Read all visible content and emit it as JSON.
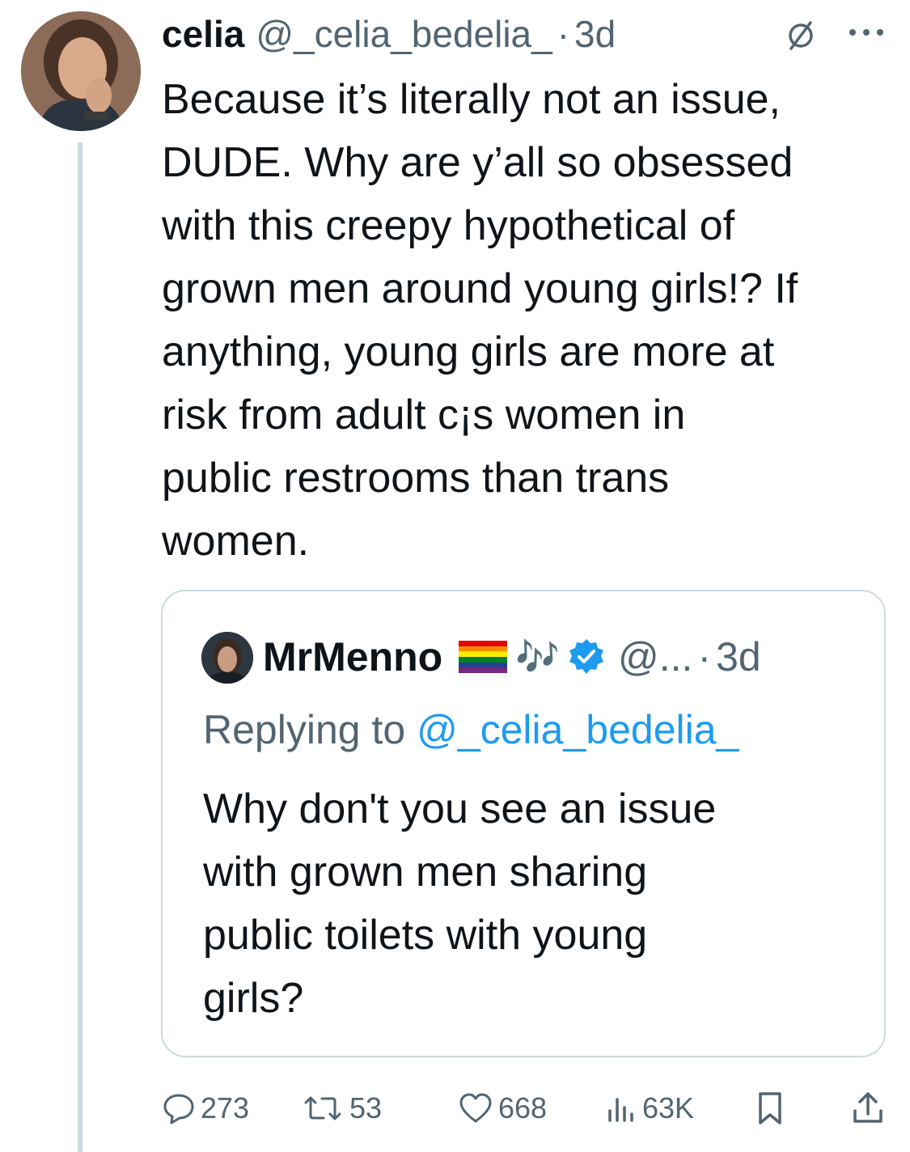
{
  "tweet": {
    "author_name": "celia",
    "author_handle": "@_celia_bedelia_",
    "separator": "·",
    "time": "3d",
    "text_lines": [
      "Because it’s literally not an issue,",
      "DUDE. Why are y’all so obsessed",
      "with this creepy hypothetical of",
      "grown men around young girls!? If",
      "anything, young girls are more at",
      "risk from adult c¡s women in",
      "public restrooms than trans",
      "women."
    ]
  },
  "quote": {
    "author_name": "MrMenno",
    "emoji_notes": "🎶",
    "handle": "@...",
    "separator": "·",
    "time": "3d",
    "replying_prefix": "Replying to",
    "replying_mention": "@_celia_bedelia_",
    "text_lines": [
      "Why don't you see an issue",
      "with grown men sharing",
      "public toilets with young",
      "girls?"
    ]
  },
  "actions": {
    "replies": "273",
    "retweets": "53",
    "likes": "668",
    "views": "63K"
  },
  "colors": {
    "text": "#0f1419",
    "muted": "#536471",
    "link": "#1d9bf0",
    "border": "#cfd9de",
    "verified": "#1d9bf0"
  },
  "icons": [
    "grok-icon",
    "more-icon",
    "verified-badge-icon",
    "rainbow-flag-icon",
    "reply-icon",
    "retweet-icon",
    "like-icon",
    "views-icon",
    "bookmark-icon",
    "share-icon"
  ]
}
